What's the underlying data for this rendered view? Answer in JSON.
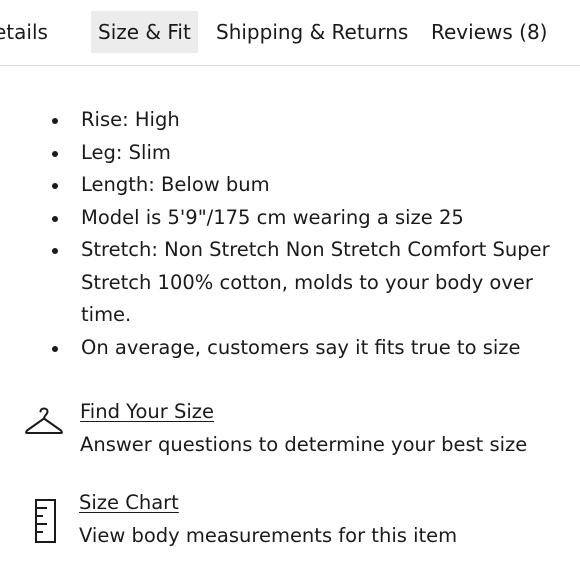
{
  "tabs": [
    {
      "label": "Details",
      "display": "etails",
      "active": false
    },
    {
      "label": "Size & Fit",
      "active": true
    },
    {
      "label": "Shipping & Returns",
      "active": false
    },
    {
      "label": "Reviews (8)",
      "active": false
    }
  ],
  "fit_details": [
    "Rise: High",
    "Leg: Slim",
    "Length: Below bum",
    "Model is 5'9\"/175 cm wearing a size 25",
    "Stretch: Non Stretch Non Stretch Comfort Super Stretch 100% cotton, molds to your body over time.",
    "On average, customers say it fits true to size"
  ],
  "find_your_size": {
    "icon": "hanger-icon",
    "link": "Find Your Size",
    "description": "Answer questions to determine your best size"
  },
  "size_chart": {
    "icon": "ruler-icon",
    "link": "Size Chart",
    "description": "View body measurements for this item"
  },
  "colors": {
    "text": "#1a1a1a",
    "active_tab_bg": "#ececec",
    "divider": "#dcdcdc"
  }
}
